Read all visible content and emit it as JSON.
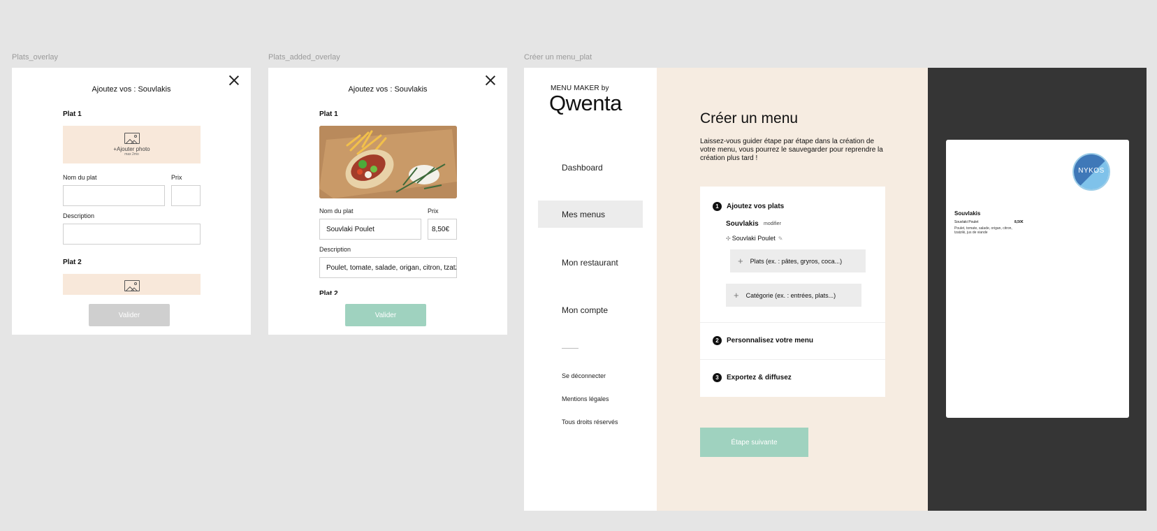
{
  "frames": {
    "overlay1_label": "Plats_overlay",
    "overlay2_label": "Plats_added_overlay",
    "main_label": "Créer un menu_plat"
  },
  "overlay1": {
    "title": "Ajoutez vos : Souvlakis",
    "plat1_label": "Plat 1",
    "add_photo": "+Ajouter photo",
    "max_size": "max 2mo",
    "name_label": "Nom du plat",
    "price_label": "Prix",
    "description_label": "Description",
    "plat2_label": "Plat 2",
    "validate": "Valider"
  },
  "overlay2": {
    "title": "Ajoutez vos : Souvlakis",
    "plat1_label": "Plat 1",
    "name_label": "Nom du plat",
    "name_value": "Souvlaki Poulet",
    "price_label": "Prix",
    "price_value": "8,50€",
    "description_label": "Description",
    "description_value": "Poulet, tomate, salade, origan, citron, tzatziki, jus de viande",
    "plat2_label": "Plat 2",
    "validate": "Valider"
  },
  "sidebar": {
    "brand_top": "MENU MAKER by",
    "brand_logo": "Qwenta",
    "nav": [
      "Dashboard",
      "Mes menus",
      "Mon restaurant",
      "Mon compte"
    ],
    "active_index": 1,
    "footer": [
      "Se déconnecter",
      "Mentions légales",
      "Tous droits réservés"
    ]
  },
  "main": {
    "title": "Créer un menu",
    "intro": "Laissez-vous guider étape par étape dans la création de votre menu, vous pourrez le sauvegarder pour reprendre la création plus tard !",
    "steps": [
      {
        "num": "1",
        "label": "Ajoutez vos plats"
      },
      {
        "num": "2",
        "label": "Personnalisez votre menu"
      },
      {
        "num": "3",
        "label": "Exportez & diffusez"
      }
    ],
    "category_name": "Souvlakis",
    "modify": "modifier",
    "dish_item": "Souvlaki Poulet",
    "add_dish_placeholder": "Plats (ex. : pâtes, gryros, coca...)",
    "add_category_placeholder": "Catégorie (ex. : entrées, plats...)",
    "next_step": "Étape suivante"
  },
  "preview": {
    "logo_text": "NYKOS",
    "category": "Souvlakis",
    "dish_name": "Souvlaki Poulet",
    "dish_price": "8,50€",
    "dish_desc": "Poulet, tomate, salade, origan, citron, tzatziki, jus de viande"
  },
  "colors": {
    "accent_green": "#9fd2bf",
    "peach": "#f8e8da",
    "dark_panel": "#353535",
    "disabled_grey": "#cfcfcf"
  }
}
